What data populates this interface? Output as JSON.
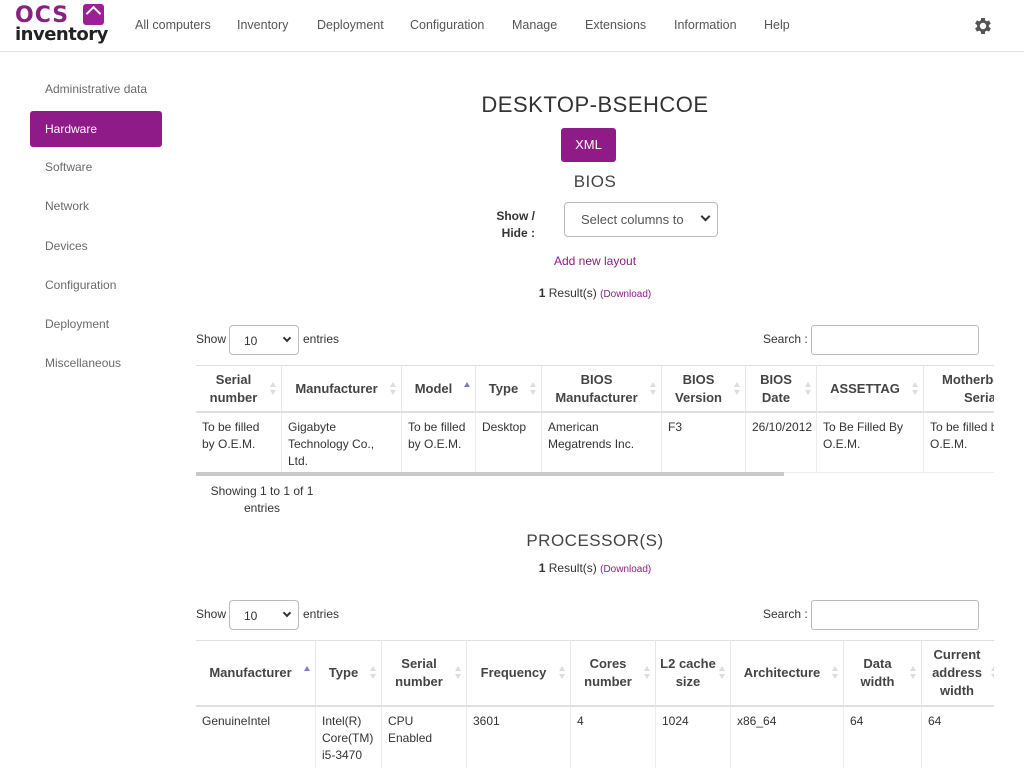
{
  "brand": {
    "top": "OCS",
    "bottom": "inventory"
  },
  "nav": {
    "items": [
      "All computers",
      "Inventory",
      "Deployment",
      "Configuration",
      "Manage",
      "Extensions",
      "Information",
      "Help"
    ]
  },
  "sidebar": {
    "items": [
      "Administrative data",
      "Hardware",
      "Software",
      "Network",
      "Devices",
      "Configuration",
      "Deployment",
      "Miscellaneous"
    ],
    "active": "Hardware"
  },
  "main": {
    "title": "DESKTOP-BSEHCOE",
    "xml_button": "XML"
  },
  "bios": {
    "title": "BIOS",
    "showhide_label_1": "Show /",
    "showhide_label_2": "Hide :",
    "select_placeholder": "Select columns to",
    "add_layout": "Add new layout",
    "results_count": "1",
    "results_label": "Result(s)",
    "download": "(Download)",
    "show_label": "Show",
    "entries_value": "10",
    "entries_label": "entries",
    "search_label": "Search :",
    "columns": [
      "Serial number",
      "Manufacturer",
      "Model",
      "Type",
      "BIOS Manufacturer",
      "BIOS Version",
      "BIOS Date",
      "ASSETTAG",
      "Motherboard Serial"
    ],
    "row": [
      "To be filled by O.E.M.",
      "Gigabyte Technology Co., Ltd.",
      "To be filled by O.E.M.",
      "Desktop",
      "American Megatrends Inc.",
      "F3",
      "26/10/2012",
      "To Be Filled By O.E.M.",
      "To be filled by O.E.M."
    ],
    "info": "Showing 1 to 1 of 1 entries"
  },
  "processor": {
    "title": "PROCESSOR(S)",
    "results_count": "1",
    "results_label": "Result(s)",
    "download": "(Download)",
    "show_label": "Show",
    "entries_value": "10",
    "entries_label": "entries",
    "search_label": "Search :",
    "columns": [
      "Manufacturer",
      "Type",
      "Serial number",
      "Frequency",
      "Cores number",
      "L2 cache size",
      "Architecture",
      "Data width",
      "Current address width"
    ],
    "row": [
      "GenuineIntel",
      "Intel(R) Core(TM) i5-3470",
      "CPU Enabled",
      "3601",
      "4",
      "1024",
      "x86_64",
      "64",
      "64"
    ]
  }
}
